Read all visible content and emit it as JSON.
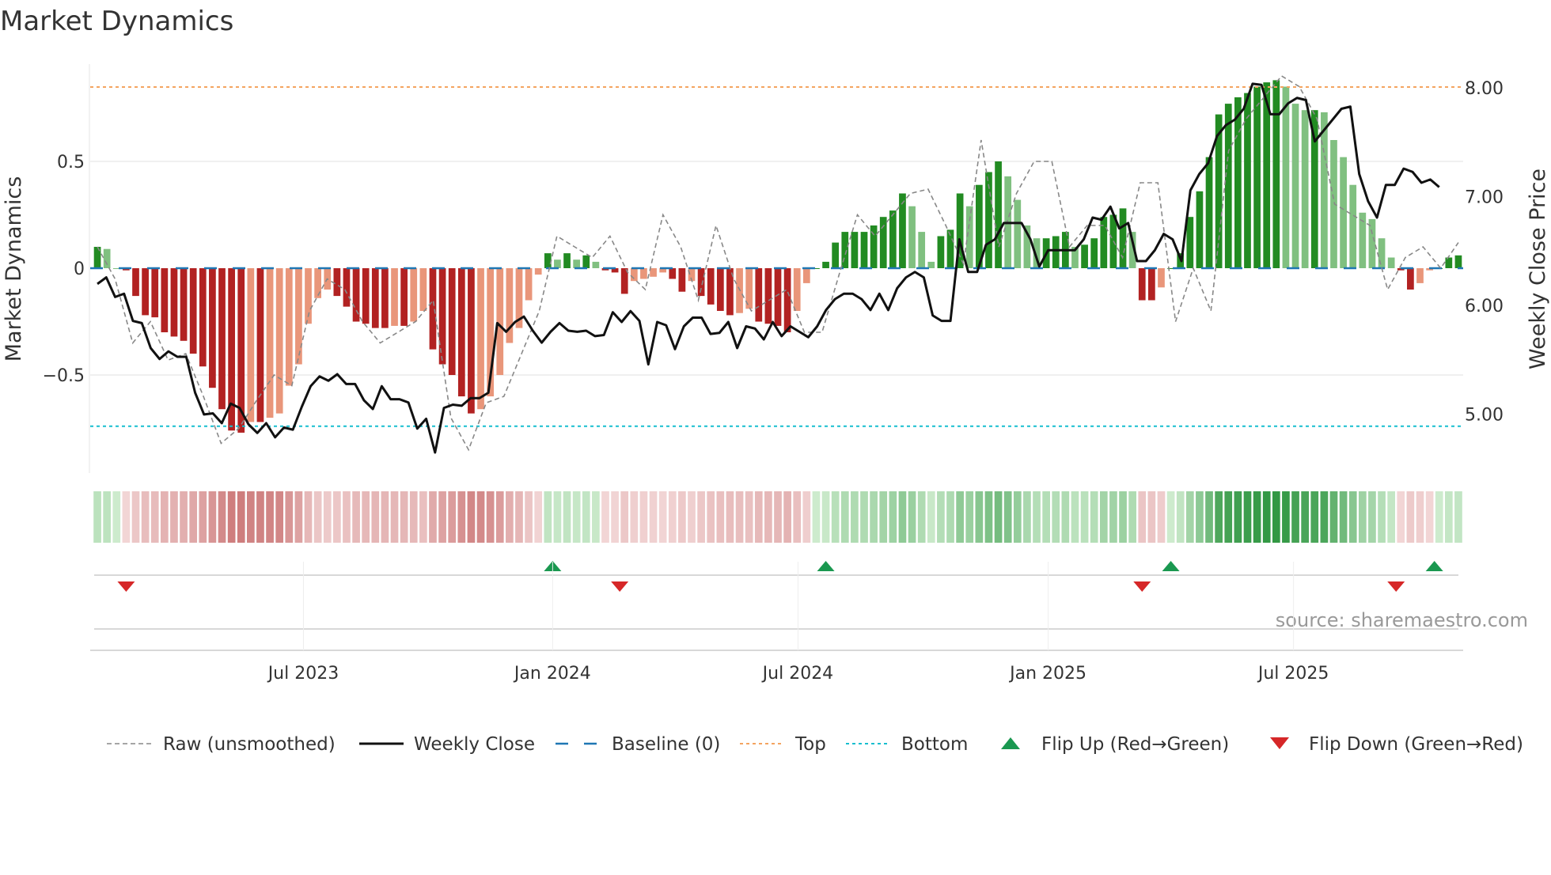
{
  "title": "Market Dynamics",
  "source": "source: sharemaestro.com",
  "colors": {
    "bar_up_strong": "#228b22",
    "bar_up_weak": "#80c080",
    "bar_down_strong": "#b22222",
    "bar_down_weak": "#e9967a",
    "close": "#111111",
    "raw": "#888888",
    "baseline": "#1f77b4",
    "top": "#f4a460",
    "bottom": "#17becf",
    "flip_up": "#1a9850",
    "flip_down": "#d62728"
  },
  "chart_data": {
    "type": "bar",
    "title": "Market Dynamics",
    "ylabel": "Market Dynamics",
    "y2label": "Weekly Close Price",
    "ylim": [
      -0.93,
      1.0
    ],
    "y_ticks": [
      {
        "v": 0.5,
        "label": "0.5"
      },
      {
        "v": 0,
        "label": "0"
      },
      {
        "v": -0.5,
        "label": "−0.5"
      }
    ],
    "y2lim": [
      4.5,
      8.2
    ],
    "y2_ticks": [
      {
        "v": 8,
        "label": "8.00"
      },
      {
        "v": 7,
        "label": "7.00"
      },
      {
        "v": 6,
        "label": "6.00"
      },
      {
        "v": 5,
        "label": "5.00"
      }
    ],
    "x_ticks": [
      {
        "week": 21.5,
        "label": "Jul 2023"
      },
      {
        "week": 47.5,
        "label": "Jan 2024"
      },
      {
        "week": 73.1,
        "label": "Jul 2024"
      },
      {
        "week": 99.2,
        "label": "Jan 2025"
      },
      {
        "week": 124.8,
        "label": "Jul 2025"
      }
    ],
    "top_level": 0.848,
    "bottom_level": -0.74,
    "baseline": 0,
    "momentum": [
      0.1,
      0.09,
      0.0,
      -0.01,
      -0.13,
      -0.22,
      -0.23,
      -0.3,
      -0.32,
      -0.34,
      -0.4,
      -0.46,
      -0.56,
      -0.66,
      -0.76,
      -0.77,
      -0.72,
      -0.72,
      -0.7,
      -0.68,
      -0.55,
      -0.45,
      -0.26,
      -0.14,
      -0.1,
      -0.13,
      -0.18,
      -0.25,
      -0.26,
      -0.28,
      -0.28,
      -0.27,
      -0.27,
      -0.25,
      -0.2,
      -0.38,
      -0.45,
      -0.5,
      -0.6,
      -0.68,
      -0.66,
      -0.6,
      -0.5,
      -0.35,
      -0.28,
      -0.15,
      -0.03,
      0.07,
      0.04,
      0.07,
      0.04,
      0.06,
      0.03,
      -0.01,
      -0.02,
      -0.12,
      -0.06,
      -0.05,
      -0.04,
      -0.02,
      -0.05,
      -0.11,
      -0.06,
      -0.13,
      -0.17,
      -0.2,
      -0.22,
      -0.21,
      -0.19,
      -0.25,
      -0.26,
      -0.27,
      -0.3,
      -0.2,
      -0.07,
      0.0,
      0.03,
      0.12,
      0.17,
      0.17,
      0.17,
      0.2,
      0.24,
      0.27,
      0.35,
      0.29,
      0.17,
      0.03,
      0.15,
      0.18,
      0.35,
      0.29,
      0.39,
      0.45,
      0.5,
      0.43,
      0.32,
      0.2,
      0.14,
      0.14,
      0.15,
      0.17,
      0.1,
      0.11,
      0.14,
      0.24,
      0.25,
      0.28,
      0.17,
      -0.15,
      -0.15,
      -0.09,
      0.0,
      0.07,
      0.24,
      0.36,
      0.52,
      0.72,
      0.77,
      0.8,
      0.82,
      0.85,
      0.87,
      0.88,
      0.85,
      0.77,
      0.74,
      0.74,
      0.73,
      0.6,
      0.52,
      0.39,
      0.26,
      0.23,
      0.14,
      0.05,
      -0.01,
      -0.1,
      -0.07,
      -0.01,
      0.0,
      0.05,
      0.06
    ],
    "raw": [
      0.1,
      -0.05,
      -0.35,
      -0.25,
      -0.43,
      -0.4,
      -0.6,
      -0.82,
      -0.75,
      -0.62,
      -0.5,
      -0.55,
      -0.2,
      -0.05,
      -0.1,
      -0.25,
      -0.35,
      -0.3,
      -0.25,
      -0.15,
      -0.7,
      -0.85,
      -0.63,
      -0.6,
      -0.4,
      -0.2,
      0.15,
      0.1,
      0.05,
      0.15,
      -0.02,
      -0.1,
      0.25,
      0.1,
      -0.15,
      0.2,
      -0.05,
      -0.2,
      -0.15,
      -0.1,
      -0.3,
      -0.3,
      -0.02,
      0.25,
      0.15,
      0.25,
      0.35,
      0.37,
      0.2,
      0.02,
      0.6,
      0.1,
      0.35,
      0.5,
      0.5,
      0.1,
      0.2,
      0.2,
      0.05,
      0.4,
      0.4,
      -0.25,
      0.0,
      -0.2,
      0.55,
      0.7,
      0.8,
      0.9,
      0.85,
      0.7,
      0.3,
      0.25,
      0.2,
      -0.1,
      0.05,
      0.1,
      0.0,
      0.12
    ],
    "close": [
      6.19,
      6.25,
      6.07,
      6.1,
      5.85,
      5.83,
      5.6,
      5.5,
      5.57,
      5.52,
      5.52,
      5.19,
      4.99,
      5.0,
      4.91,
      5.09,
      5.05,
      4.9,
      4.82,
      4.91,
      4.78,
      4.87,
      4.85,
      5.06,
      5.25,
      5.34,
      5.3,
      5.36,
      5.27,
      5.27,
      5.12,
      5.04,
      5.25,
      5.13,
      5.13,
      5.1,
      4.86,
      4.95,
      4.64,
      5.05,
      5.08,
      5.07,
      5.14,
      5.14,
      5.19,
      5.83,
      5.75,
      5.84,
      5.89,
      5.76,
      5.65,
      5.75,
      5.83,
      5.76,
      5.75,
      5.76,
      5.71,
      5.72,
      5.93,
      5.84,
      5.94,
      5.85,
      5.45,
      5.84,
      5.81,
      5.59,
      5.8,
      5.88,
      5.88,
      5.73,
      5.74,
      5.84,
      5.6,
      5.8,
      5.78,
      5.68,
      5.84,
      5.71,
      5.8,
      5.75,
      5.7,
      5.8,
      5.95,
      6.05,
      6.1,
      6.1,
      6.05,
      5.95,
      6.1,
      5.95,
      6.15,
      6.25,
      6.3,
      6.25,
      5.9,
      5.85,
      5.85,
      6.6,
      6.3,
      6.3,
      6.55,
      6.6,
      6.75,
      6.75,
      6.75,
      6.6,
      6.35,
      6.5,
      6.5,
      6.5,
      6.5,
      6.6,
      6.8,
      6.78,
      6.9,
      6.7,
      6.75,
      6.4,
      6.4,
      6.5,
      6.65,
      6.6,
      6.4,
      7.05,
      7.2,
      7.3,
      7.55,
      7.65,
      7.7,
      7.8,
      8.03,
      8.02,
      7.75,
      7.75,
      7.85,
      7.9,
      7.88,
      7.5,
      7.6,
      7.7,
      7.8,
      7.82,
      7.2,
      6.95,
      6.8,
      7.1,
      7.1,
      7.25,
      7.22,
      7.12,
      7.15,
      7.08
    ],
    "flips_up_week": [
      47.5,
      76,
      112,
      139.5
    ],
    "flips_down_week": [
      3,
      54.5,
      109,
      135.5
    ],
    "legend": [
      {
        "key": "raw",
        "label": "Raw (unsmoothed)"
      },
      {
        "key": "close",
        "label": "Weekly Close"
      },
      {
        "key": "baseline",
        "label": "Baseline (0)"
      },
      {
        "key": "top",
        "label": "Top"
      },
      {
        "key": "bottom",
        "label": "Bottom"
      },
      {
        "key": "flip_up",
        "label": "Flip Up (Red→Green)"
      },
      {
        "key": "flip_down",
        "label": "Flip Down (Green→Red)"
      }
    ],
    "legend_placement": "bottom"
  }
}
